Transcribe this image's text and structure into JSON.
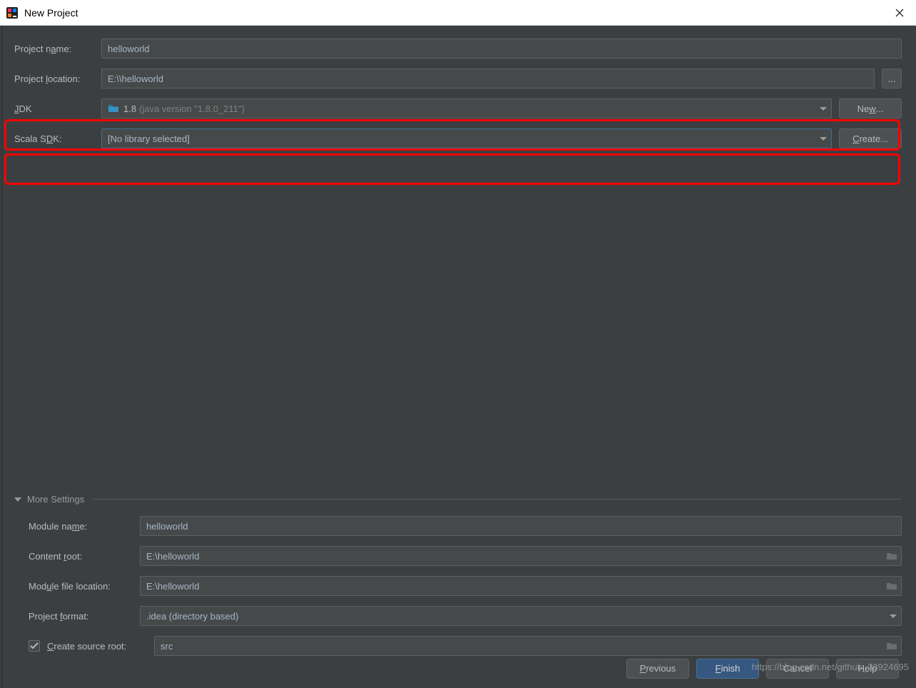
{
  "window": {
    "title": "New Project"
  },
  "fields": {
    "project_name_label": "Project name:",
    "project_name_value": "helloworld",
    "project_location_label": "Project location:",
    "project_location_value": "E:\\\\helloworld",
    "jdk_label": "JDK",
    "jdk_value_main": "1.8",
    "jdk_value_sub": "(java version \"1.8.0_211\")",
    "jdk_new_button": "New...",
    "scala_sdk_label": "Scala SDK:",
    "scala_sdk_value": "[No library selected]",
    "scala_create_button": "Create...",
    "ellipsis": "..."
  },
  "more": {
    "header": "More Settings",
    "module_name_label": "Module name:",
    "module_name_value": "helloworld",
    "content_root_label": "Content root:",
    "content_root_value": "E:\\helloworld",
    "module_file_loc_label": "Module file location:",
    "module_file_loc_value": "E:\\helloworld",
    "project_format_label": "Project format:",
    "project_format_value": ".idea (directory based)",
    "source_root_label": "Create source root:",
    "source_root_value": "src",
    "source_root_checked": true
  },
  "footer": {
    "previous": "Previous",
    "finish": "Finish",
    "cancel": "Cancel",
    "help": "Help"
  },
  "watermark": "https://blog.csdn.net/github_38924695",
  "icons": {
    "close": "close-icon",
    "app": "intellij-icon",
    "folder": "folder-icon"
  }
}
